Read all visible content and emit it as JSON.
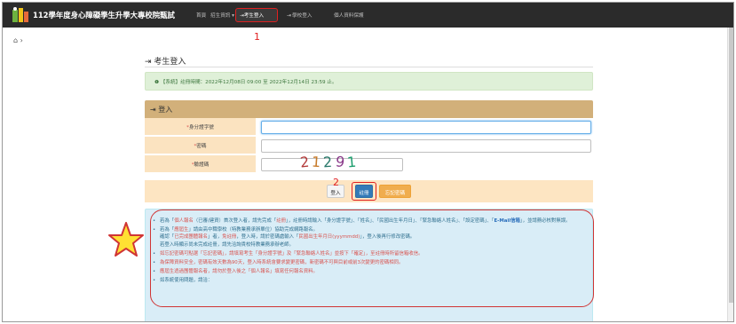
{
  "navbar": {
    "site_title": "112學年度身心障礙學生升學大專校院甄試",
    "links": [
      {
        "label": "首頁"
      },
      {
        "label": "招生資訊 ▾"
      },
      {
        "label": "考生登入",
        "icon": "login-icon",
        "active": true
      },
      {
        "label": "學校登入",
        "icon": "login-icon"
      },
      {
        "label": "個人資料保護"
      }
    ]
  },
  "annotations": {
    "marker_1": "1",
    "marker_2": "2"
  },
  "breadcrumb": {
    "home_icon": "home-icon",
    "separator": "›"
  },
  "page": {
    "title": "考生登入",
    "title_icon": "login-icon"
  },
  "notice": {
    "text": "【系統】註冊時間：2022年12月08日 09:00 至 2022年12月14日 23:59 止。"
  },
  "login_panel": {
    "title": "登入",
    "fields": [
      {
        "label": "身分證字號",
        "value": "",
        "placeholder": ""
      },
      {
        "label": "密碼",
        "value": "",
        "placeholder": ""
      },
      {
        "label": "驗證碼",
        "value": "",
        "placeholder": ""
      }
    ],
    "captcha": "21291",
    "buttons": {
      "login": "登入",
      "register": "註冊",
      "forgot": "忘記密碼"
    }
  },
  "info": {
    "items": [
      {
        "parts": [
          {
            "t": "若為「",
            "s": "n"
          },
          {
            "t": "個人報名",
            "s": "r"
          },
          {
            "t": "（已審/建資）首次登入者，請先完成「",
            "s": "n"
          },
          {
            "t": "註冊",
            "s": "r"
          },
          {
            "t": "」，註冊時請輸入「身分證字號」、「姓名」、「民國出生年月日」、「緊急聯絡人姓名」、「設定密碼」、「",
            "s": "n"
          },
          {
            "t": "E-Mail信箱",
            "s": "b"
          },
          {
            "t": "」，並請務必核對無誤。",
            "s": "n"
          }
        ]
      },
      {
        "parts": [
          {
            "t": "若為「",
            "s": "n"
          },
          {
            "t": "應屆生",
            "s": "r"
          },
          {
            "t": "」請由高中職學校（特教業務承辦單位）協助完成網路報名。",
            "s": "n"
          }
        ],
        "sub": [
          [
            {
              "t": "確認「",
              "s": "n"
            },
            {
              "t": "已完成團體報名",
              "s": "r"
            },
            {
              "t": "」者，",
              "s": "n"
            },
            {
              "t": "免註冊",
              "s": "r"
            },
            {
              "t": "，登入時，請於密碼處輸入「",
              "s": "n"
            },
            {
              "t": "民國出生年月日(yyymmdd)",
              "s": "r"
            },
            {
              "t": "」，登入後再行修改密碼。",
              "s": "n"
            }
          ],
          [
            {
              "t": "若登入時顯示尚未完成註冊，請先洽詢貴校特教業務承辦老師。",
              "s": "n"
            }
          ]
        ]
      },
      {
        "parts": [
          {
            "t": "如忘記密碼可點選「忘記密碼」，請填寫考生「身分證字號」及「緊急聯絡人姓名」並按下「確定」，至註冊時所留信箱收信。",
            "s": "r"
          }
        ]
      },
      {
        "parts": [
          {
            "t": "為保障資料安全，密碼有效天數為90天，登入時系統會要求變更密碼，新密碼不可與目前或前3次變更的密碼相同。",
            "s": "r"
          }
        ]
      },
      {
        "parts": [
          {
            "t": "應屆生透過團體報名者，請勿於登入後之「個人報名」填寫任何報名資料。",
            "s": "r"
          }
        ]
      },
      {
        "parts": [
          {
            "t": "如系統使用問題，請洽：",
            "s": "n"
          }
        ]
      }
    ]
  },
  "colors": {
    "navbar_bg": "#2b2b2b",
    "annotation_red": "#e02020",
    "panel_head": "#d2b07a",
    "label_bg": "#fbe3c0",
    "info_bg": "#d9edf7",
    "star_fill": "#ffe033"
  }
}
